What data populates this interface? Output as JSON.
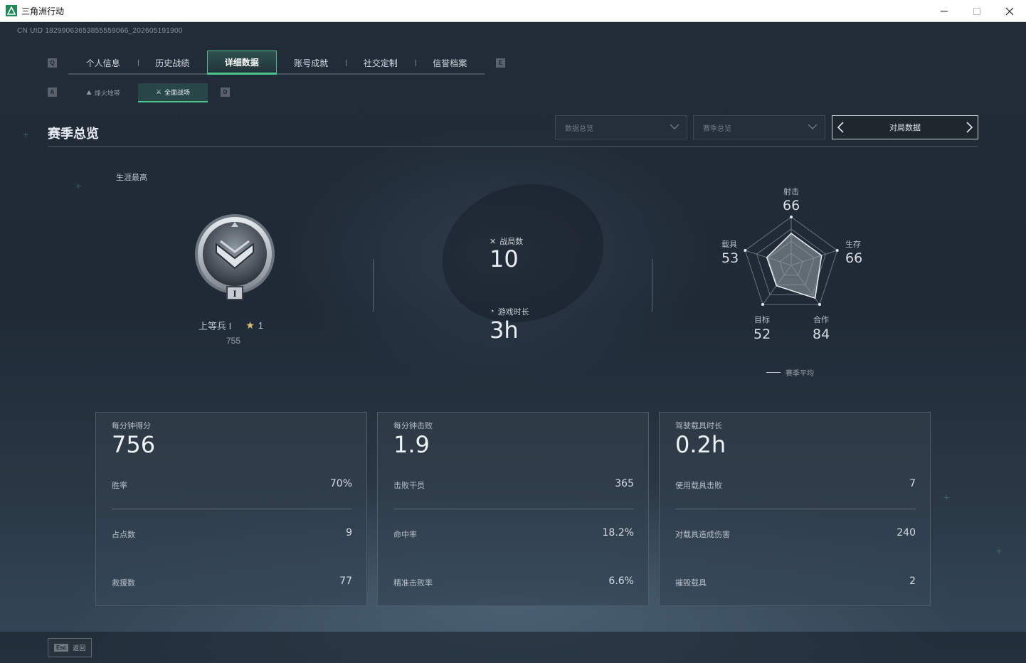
{
  "window": {
    "title": "三角洲行动"
  },
  "uid": "CN UID 18299063653855559066_202605191900",
  "key_hints": {
    "tab_prev": "Q",
    "tab_next": "E",
    "subtab_prev": "A",
    "subtab_next": "D"
  },
  "tabs": [
    {
      "label": "个人信息"
    },
    {
      "label": "历史战绩"
    },
    {
      "label": "详细数据",
      "active": true
    },
    {
      "label": "账号成就"
    },
    {
      "label": "社交定制"
    },
    {
      "label": "信誉档案"
    }
  ],
  "subtabs": [
    {
      "label": "烽火地带",
      "icon": "flame-icon"
    },
    {
      "label": "全面战场",
      "icon": "battlefield-icon",
      "active": true
    }
  ],
  "section": {
    "title": "赛季总览"
  },
  "filters": {
    "data_overview": "数据总览",
    "season_overview": "赛季总览",
    "match_data": "对局数据"
  },
  "rank": {
    "label": "生涯最高",
    "name": "上等兵 I",
    "stars": "1",
    "score": "755",
    "badge_numeral": "I"
  },
  "battle_stats": {
    "matches_label": "战局数",
    "matches_value": "10",
    "playtime_label": "游戏时长",
    "playtime_value": "3h"
  },
  "radar": {
    "axes": [
      {
        "label": "射击",
        "value": "66"
      },
      {
        "label": "生存",
        "value": "66"
      },
      {
        "label": "合作",
        "value": "84"
      },
      {
        "label": "目标",
        "value": "52"
      },
      {
        "label": "载具",
        "value": "53"
      }
    ],
    "legend": "赛季平均"
  },
  "cards": [
    {
      "head_label": "每分钟得分",
      "head_value": "756",
      "rows": [
        {
          "label": "胜率",
          "value": "70%"
        },
        {
          "label": "占点数",
          "value": "9"
        },
        {
          "label": "救援数",
          "value": "77"
        }
      ]
    },
    {
      "head_label": "每分钟击败",
      "head_value": "1.9",
      "rows": [
        {
          "label": "击败干员",
          "value": "365"
        },
        {
          "label": "命中率",
          "value": "18.2%"
        },
        {
          "label": "精准击败率",
          "value": "6.6%"
        }
      ]
    },
    {
      "head_label": "驾驶载具时长",
      "head_value": "0.2h",
      "rows": [
        {
          "label": "使用载具击败",
          "value": "7"
        },
        {
          "label": "对载具造成伤害",
          "value": "240"
        },
        {
          "label": "摧毁载具",
          "value": "2"
        }
      ]
    }
  ],
  "footer": {
    "esc_key": "Esc",
    "back_label": "返回"
  },
  "colors": {
    "accent": "#49c68e",
    "background": "#1f2a36"
  }
}
